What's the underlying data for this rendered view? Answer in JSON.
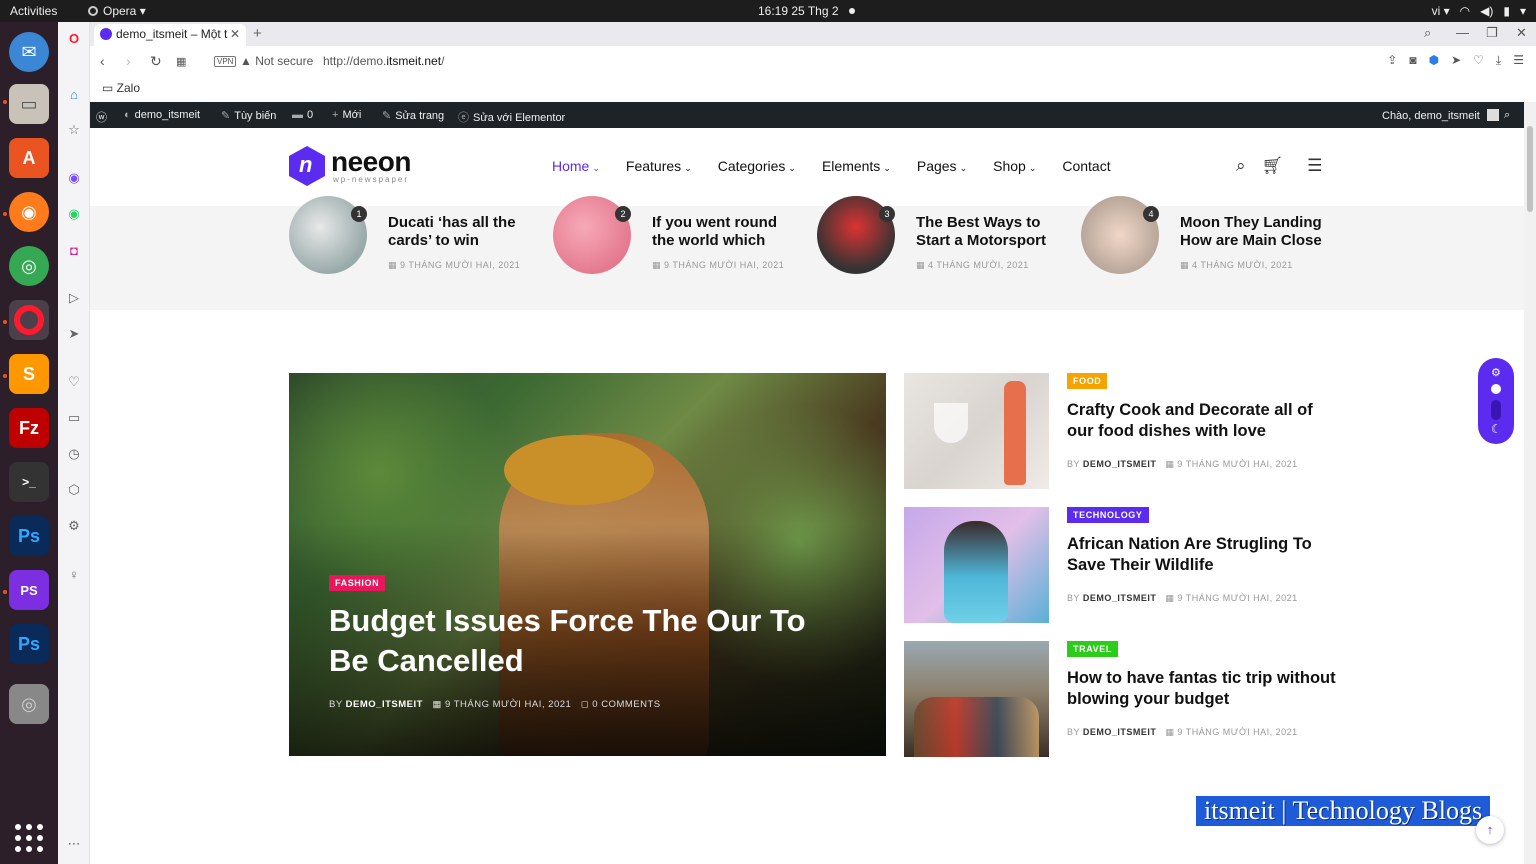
{
  "os": {
    "activities": "Activities",
    "app": "Opera",
    "clock": "16:19  25 Thg 2",
    "lang": "vi"
  },
  "browser": {
    "tab_title": "demo_itsmeit – Một t",
    "vpn": "VPN",
    "not_secure": "Not secure",
    "url_prefix": "http://demo.",
    "url_domain": "itsmeit.net",
    "url_suffix": "/",
    "bookmark": "Zalo"
  },
  "wpbar": {
    "site": "demo_itsmeit",
    "customize": "Tùy biến",
    "comments": "0",
    "new": "Mới",
    "edit": "Sửa trang",
    "elementor": "Sửa với Elementor",
    "greeting": "Chào, demo_itsmeit"
  },
  "site": {
    "logo": "neeon",
    "tagline": "wp-newspaper",
    "menu": [
      {
        "label": "Home",
        "caret": true
      },
      {
        "label": "Features",
        "caret": true
      },
      {
        "label": "Categories",
        "caret": true
      },
      {
        "label": "Elements",
        "caret": true
      },
      {
        "label": "Pages",
        "caret": true
      },
      {
        "label": "Shop",
        "caret": true
      },
      {
        "label": "Contact",
        "caret": false
      }
    ]
  },
  "trending": [
    {
      "num": "1",
      "title": "Ducati ‘has all the cards’ to win",
      "date": "9 THÁNG MƯỜI HAI, 2021"
    },
    {
      "num": "2",
      "title": "If you went round the world which",
      "date": "9 THÁNG MƯỜI HAI, 2021"
    },
    {
      "num": "3",
      "title": "The Best Ways to Start a Motorsport",
      "date": "4 THÁNG MƯỜI, 2021"
    },
    {
      "num": "4",
      "title": "Moon They Landing How are Main Close",
      "date": "4 THÁNG MƯỜI, 2021"
    }
  ],
  "hero": {
    "category": "FASHION",
    "title": "Budget Issues Force The Our To Be Cancelled",
    "by": "BY",
    "author": "DEMO_ITSMEIT",
    "date": "9 THÁNG MƯỜI HAI, 2021",
    "comments": "0 COMMENTS"
  },
  "side_posts": [
    {
      "category": "FOOD",
      "color": "#f5a300",
      "title": "Crafty Cook and Decorate all of our food dishes with love",
      "by": "BY",
      "author": "DEMO_ITSMEIT",
      "date": "9 THÁNG MƯỜI HAI, 2021"
    },
    {
      "category": "TECHNOLOGY",
      "color": "#5b2cf0",
      "title": "African Nation Are Strugling To Save Their Wildlife",
      "by": "BY",
      "author": "DEMO_ITSMEIT",
      "date": "9 THÁNG MƯỜI HAI, 2021"
    },
    {
      "category": "TRAVEL",
      "color": "#2ecc1a",
      "title": "How to have fantas tic trip without blowing your budget",
      "by": "BY",
      "author": "DEMO_ITSMEIT",
      "date": "9 THÁNG MƯỜI HAI, 2021"
    }
  ],
  "watermark": "itsmeit | Technology Blogs"
}
